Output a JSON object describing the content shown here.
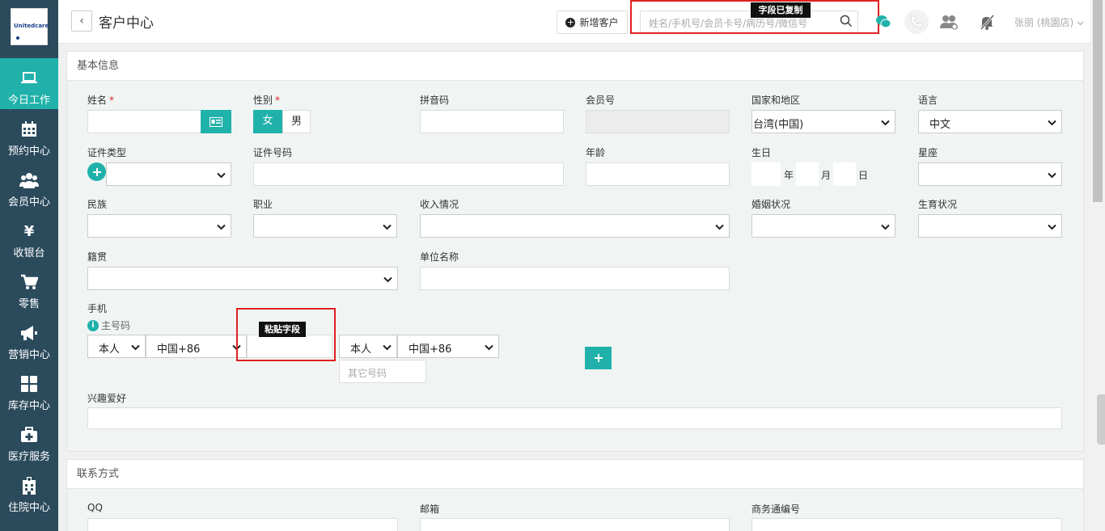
{
  "sidebar": {
    "logo_text": "Unitedcare",
    "items": [
      {
        "label": "今日工作",
        "icon": "laptop-icon"
      },
      {
        "label": "预约中心",
        "icon": "calendar-icon"
      },
      {
        "label": "会员中心",
        "icon": "users-icon"
      },
      {
        "label": "收银台",
        "icon": "yen-icon"
      },
      {
        "label": "零售",
        "icon": "cart-icon"
      },
      {
        "label": "营销中心",
        "icon": "megaphone-icon"
      },
      {
        "label": "库存中心",
        "icon": "grid-icon"
      },
      {
        "label": "医疗服务",
        "icon": "medkit-icon"
      },
      {
        "label": "住院中心",
        "icon": "hospital-icon"
      }
    ]
  },
  "topbar": {
    "back": "‹",
    "title": "客户中心",
    "new_customer": "新增客户",
    "search_placeholder": "姓名/手机号/会员卡号/病历号/微信号",
    "copied_tip": "字段已复制",
    "user": "张丽 (桃園店)"
  },
  "basic": {
    "header": "基本信息",
    "name_label": "姓名",
    "required_mark": "*",
    "gender_label": "性别",
    "gender_female": "女",
    "gender_male": "男",
    "pinyin_label": "拼音码",
    "member_no_label": "会员号",
    "country_label": "国家和地区",
    "country_value": "台湾(中国)",
    "language_label": "语言",
    "language_value": "中文",
    "id_type_label": "证件类型",
    "id_no_label": "证件号码",
    "age_label": "年龄",
    "birthday_label": "生日",
    "year": "年",
    "month": "月",
    "day": "日",
    "zodiac_label": "星座",
    "ethnicity_label": "民族",
    "job_label": "职业",
    "income_label": "收入情况",
    "marital_label": "婚姻状况",
    "fertility_label": "生育状况",
    "native_label": "籍贯",
    "company_label": "单位名称",
    "mobile_label": "手机",
    "primary_label": "主号码",
    "relation_value": "本人",
    "area_code_value": "中国+86",
    "paste_tip": "粘贴字段",
    "other_placeholder": "其它号码",
    "hobby_label": "兴趣爱好"
  },
  "contact": {
    "header": "联系方式",
    "qq_label": "QQ",
    "email_label": "邮箱",
    "biz_label": "商务通编号"
  },
  "colors": {
    "sidebar": "#2b4a5c",
    "accent": "#20b2aa",
    "highlight": "#e02020"
  }
}
